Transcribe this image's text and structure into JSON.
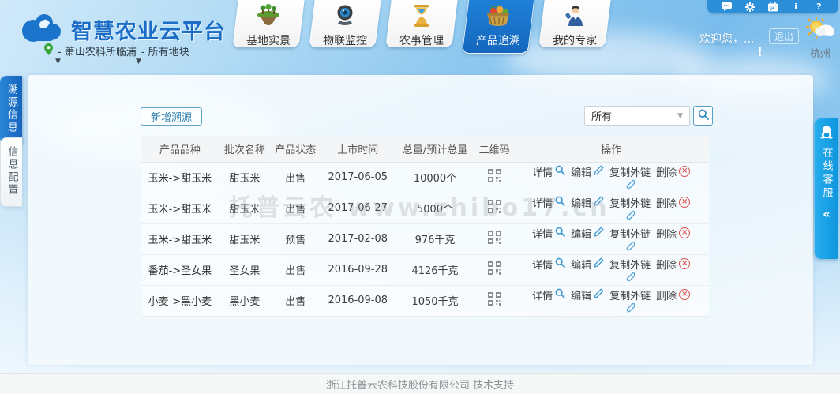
{
  "header": {
    "title": "智慧农业云平台",
    "location": {
      "site": "- 萧山农科所临浦",
      "plot": "- 所有地块",
      "caret": "▼"
    },
    "nav_tabs": [
      {
        "label": "基地实景",
        "icon": "island-icon",
        "active": false
      },
      {
        "label": "物联监控",
        "icon": "webcam-icon",
        "active": false
      },
      {
        "label": "农事管理",
        "icon": "hourglass-icon",
        "active": false
      },
      {
        "label": "产品追溯",
        "icon": "basket-icon",
        "active": true
      },
      {
        "label": "我的专家",
        "icon": "expert-icon",
        "active": false
      }
    ],
    "iconbar": [
      "chat-icon",
      "gear-icon",
      "calendar-icon",
      "info-icon",
      "help-icon"
    ],
    "info_glyph": "i",
    "help_glyph": "?",
    "welcome": "欢迎您，...",
    "logout_label": "退出",
    "alert_mark": "!",
    "weather_city": "杭州"
  },
  "sidebar": {
    "tabs": [
      {
        "label": "溯源信息",
        "active": true
      },
      {
        "label": "信息配置",
        "active": false
      }
    ]
  },
  "toolbar": {
    "add_label": "新增溯源",
    "filter_value": "所有",
    "filter_caret": "▼"
  },
  "table": {
    "headers": [
      "产品品种",
      "批次名称",
      "产品状态",
      "上市时间",
      "总量/预计总量",
      "二维码",
      "操作"
    ],
    "rows": [
      {
        "variety": "玉米->甜玉米",
        "batch": "甜玉米",
        "status": "出售",
        "date": "2017-06-05",
        "quantity": "10000个"
      },
      {
        "variety": "玉米->甜玉米",
        "batch": "甜玉米",
        "status": "出售",
        "date": "2017-06-27",
        "quantity": "5000个"
      },
      {
        "variety": "玉米->甜玉米",
        "batch": "甜玉米",
        "status": "预售",
        "date": "2017-02-08",
        "quantity": "976千克"
      },
      {
        "variety": "番茄->圣女果",
        "batch": "圣女果",
        "status": "出售",
        "date": "2016-09-28",
        "quantity": "4126千克"
      },
      {
        "variety": "小麦->黑小麦",
        "batch": "黑小麦",
        "status": "出售",
        "date": "2016-09-08",
        "quantity": "1050千克"
      }
    ]
  },
  "actions": {
    "detail": "详情",
    "edit": "编辑",
    "copy_link": "复制外链",
    "delete": "删除",
    "delete_glyph": "×"
  },
  "watermark": "托普云农 www.zhibo17.cn",
  "service_tab": {
    "label": "在线客服",
    "collapse": "«"
  },
  "footer": "浙江托普云农科技股份有限公司 技术支持",
  "colors": {
    "title_blue": "#1b6dc6",
    "active_tab_blue": "#1a74cd",
    "service_blue": "#17a0e4",
    "accent_teal": "#2f7fae",
    "link_icon_blue": "#4a9ed6",
    "delete_red": "#d9534f",
    "sky_blue": "#8ec8ef"
  }
}
